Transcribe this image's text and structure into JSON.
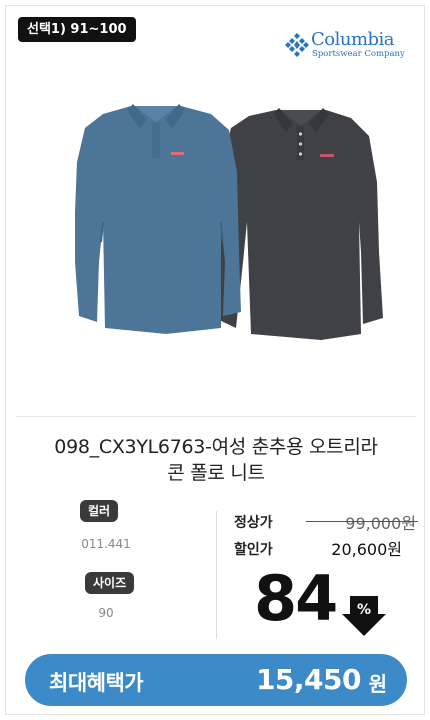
{
  "badge": "선택1) 91~100",
  "brand": {
    "name": "Columbia",
    "subtitle": "Sportswear Company",
    "color": "#2874c4"
  },
  "product": {
    "title_line1": "098_CX3YL6763-여성 춘추용 오트리라",
    "title_line2": "콘 폴로 니트",
    "image_colors": [
      "#4d7597",
      "#3f4147"
    ]
  },
  "options": {
    "color_label": "컬러",
    "color_value": "011.441",
    "size_label": "사이즈",
    "size_value": "90"
  },
  "price": {
    "regular_label": "정상가",
    "regular_value": "99,000원",
    "sale_label": "할인가",
    "sale_value": "20,600원",
    "discount_rate": "84",
    "discount_sign": "%"
  },
  "best": {
    "label": "최대혜택가",
    "price": "15,450",
    "unit": "원",
    "color": "#3c8bc8"
  }
}
